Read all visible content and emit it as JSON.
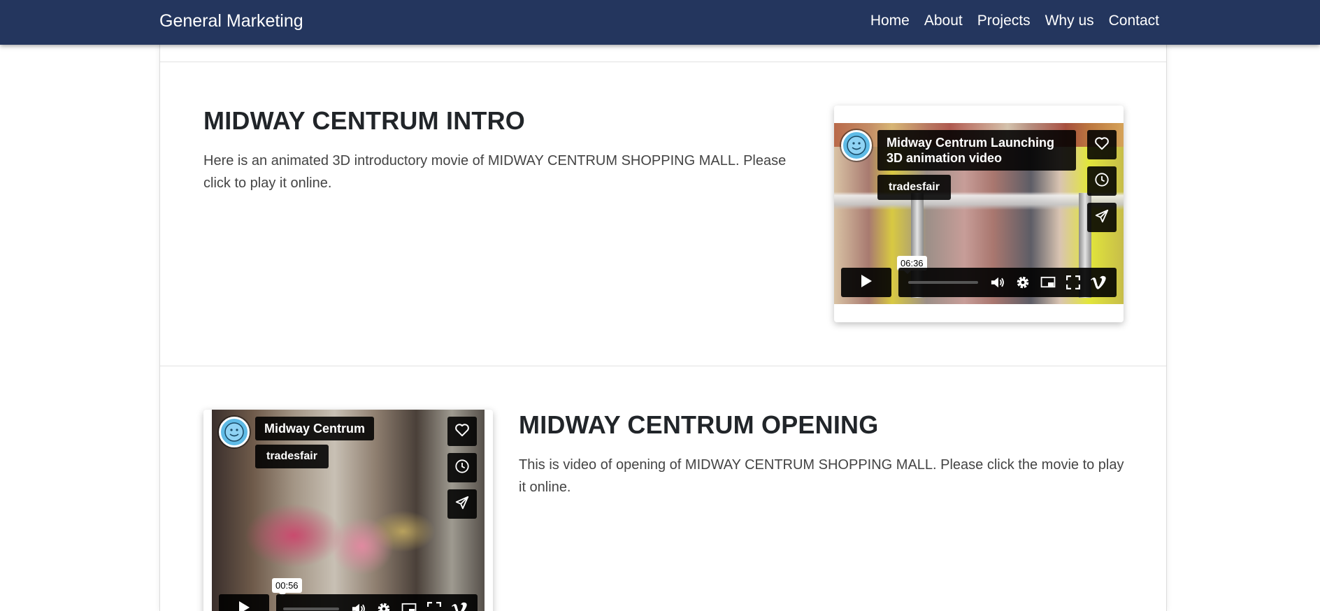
{
  "navbar": {
    "brand": "General Marketing",
    "links": [
      "Home",
      "About",
      "Projects",
      "Why us",
      "Contact"
    ]
  },
  "sections": [
    {
      "title": "MIDWAY CENTRUM INTRO",
      "text": "Here is an animated 3D introductory movie of MIDWAY CENTRUM SHOPPING MALL. Please click to play it online.",
      "video": {
        "title": "Midway Centrum Launching 3D animation video",
        "author": "tradesfair",
        "duration": "06:36"
      }
    },
    {
      "title": "MIDWAY CENTRUM OPENING",
      "text": "This is video of opening of MIDWAY CENTRUM SHOPPING MALL. Please click the movie to play it online.",
      "video": {
        "title": "Midway Centrum",
        "author": "tradesfair",
        "duration": "00:56"
      }
    }
  ],
  "icons": {
    "like": "heart-icon",
    "watch_later": "clock-icon",
    "share": "send-icon",
    "play": "play-icon",
    "volume": "volume-icon",
    "settings": "gear-icon",
    "pip": "pip-icon",
    "fullscreen": "fullscreen-icon",
    "vimeo": "vimeo-logo-icon"
  },
  "colors": {
    "navbar": "#24365e",
    "text": "#212529",
    "avatar": "#5fbbe6"
  }
}
